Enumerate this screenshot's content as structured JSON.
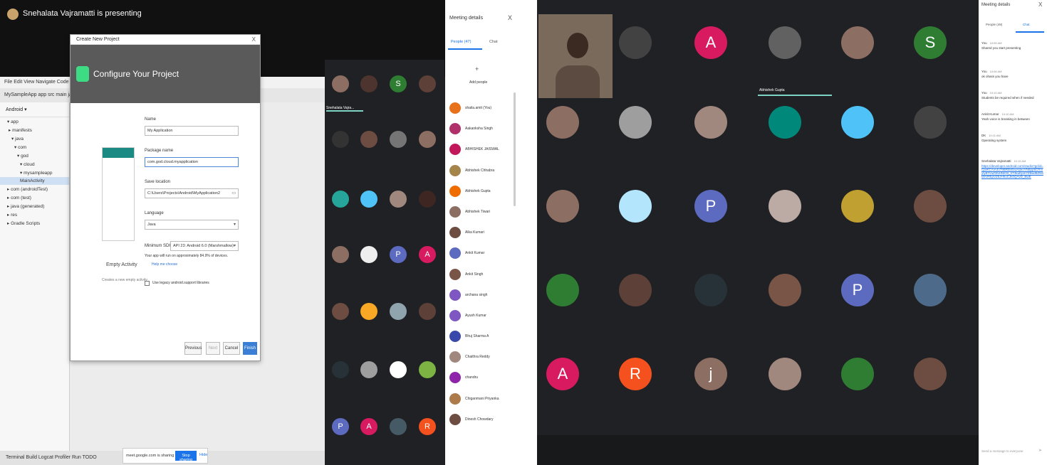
{
  "left": {
    "presenter_text": "Snehalata Vajramatti is presenting",
    "studio": {
      "menu": "File  Edit  View  Navigate  Code  Analyze  Refactor  Build  Run  Tools  VCS  Window  Help",
      "breadcrumb": "MySampleApp  app  src  main  java  com  god  cloud  mysampleapp  MainActivity",
      "tree_header": "Android ▾",
      "tree_items": [
        "▾ app",
        "▸ manifests",
        "▾ java",
        "▾ com",
        "▾ god",
        "▾ cloud",
        "▾ mysampleapp",
        "MainActivity",
        "▸ com (androidTest)",
        "▸ com (test)",
        "▸ java (generated)",
        "▸ res",
        "▸ Gradle Scripts"
      ],
      "statusbar": "Terminal   Build   Logcat   Profiler   Run   TODO",
      "dialog": {
        "title": "Create New Project",
        "close": "X",
        "header": "Configure Your Project",
        "activity_label": "Empty Activity",
        "activity_desc": "Creates a new empty activity",
        "name_label": "Name",
        "name_value": "My Application",
        "package_label": "Package name",
        "package_value": "com.god.cloud.myapplication",
        "save_label": "Save location",
        "save_value": "C:\\Users\\Projects\\Android\\MyApplication2",
        "language_label": "Language",
        "language_value": "Java",
        "minsdk_label": "Minimum SDK",
        "minsdk_value": "API 23: Android 6.0 (Marshmallow)",
        "note": "Your app will run on approximately 84.9% of devices.",
        "note_link": "Help me choose",
        "legacy_label": "Use legacy android.support libraries",
        "buttons": {
          "previous": "Previous",
          "next": "Next",
          "cancel": "Cancel",
          "finish": "Finish"
        }
      }
    },
    "share_text": "meet.google.com is sharing your screen.",
    "share_button": "Stop sharing",
    "share_hide": "Hide",
    "presenter_tag": "Snehalata Vajra...",
    "panel": {
      "title": "Meeting details",
      "close": "X",
      "tab_people": "People (47)",
      "tab_chat": "Chat",
      "add_icon_glyph": "+",
      "add_label": "Add people",
      "people": [
        {
          "name": "shaila.amit (You)",
          "color": "#e8711c"
        },
        {
          "name": "Aakanksha Singh",
          "color": "#b0306a"
        },
        {
          "name": "ABHISHEK JAISWAL",
          "color": "#c2185b"
        },
        {
          "name": "Abhishek Chhabra",
          "color": "#a5854a"
        },
        {
          "name": "Abhishek Gupta",
          "color": "#ef6c00"
        },
        {
          "name": "Abhishek Tiwari",
          "color": "#8d6e63"
        },
        {
          "name": "Alka Kumari",
          "color": "#6d4c41"
        },
        {
          "name": "Ankit Kumar",
          "color": "#5c6bc0"
        },
        {
          "name": "Ankit Singh",
          "color": "#795548"
        },
        {
          "name": "archana singh",
          "color": "#7e57c2"
        },
        {
          "name": "Ayush Kumar",
          "color": "#7e57c2"
        },
        {
          "name": "Bhuj Sharma A",
          "color": "#3949ab"
        },
        {
          "name": "Chaithra Reddy",
          "color": "#a1887f"
        },
        {
          "name": "chandru",
          "color": "#8e24aa"
        },
        {
          "name": "Chiganmani Priyanka",
          "color": "#ad7a4a"
        },
        {
          "name": "Dinesh Chowdary",
          "color": "#6d4c41"
        }
      ]
    },
    "tiles": [
      {
        "letter": "",
        "color": "#8d6e63"
      },
      {
        "letter": "",
        "color": "#4e342e"
      },
      {
        "letter": "S",
        "color": "#2e7d32"
      },
      {
        "letter": "",
        "color": "#5d4037"
      },
      {
        "letter": "",
        "color": "#333333"
      },
      {
        "letter": "",
        "color": "#6d4c41"
      },
      {
        "letter": "",
        "color": "#757575"
      },
      {
        "letter": "",
        "color": "#8d6e63"
      },
      {
        "letter": "",
        "color": "#26a69a"
      },
      {
        "letter": "",
        "color": "#4fc3f7"
      },
      {
        "letter": "",
        "color": "#a1887f"
      },
      {
        "letter": "",
        "color": "#3e2723"
      },
      {
        "letter": "",
        "color": "#8d6e63"
      },
      {
        "letter": "",
        "color": "#eeeeee"
      },
      {
        "letter": "P",
        "color": "#5c6bc0"
      },
      {
        "letter": "A",
        "color": "#d81b60"
      },
      {
        "letter": "",
        "color": "#6d4c41"
      },
      {
        "letter": "",
        "color": "#f9a825"
      },
      {
        "letter": "",
        "color": "#90a4ae"
      },
      {
        "letter": "",
        "color": "#5d4037"
      },
      {
        "letter": "",
        "color": "#263238"
      },
      {
        "letter": "",
        "color": "#9e9e9e"
      },
      {
        "letter": "",
        "color": "#ffffff"
      },
      {
        "letter": "",
        "color": "#7cb342"
      },
      {
        "letter": "P",
        "color": "#5c6bc0"
      },
      {
        "letter": "A",
        "color": "#d81b60"
      },
      {
        "letter": "",
        "color": "#455a64"
      },
      {
        "letter": "R",
        "color": "#f4511e"
      }
    ]
  },
  "right": {
    "speaker_tag": "Abhishek Gupta",
    "tiles": [
      {
        "letter": "",
        "color": "#424242"
      },
      {
        "letter": "A",
        "color": "#d81b60"
      },
      {
        "letter": "",
        "color": "#616161"
      },
      {
        "letter": "",
        "color": "#8d6e63"
      },
      {
        "letter": "S",
        "color": "#2e7d32"
      },
      {
        "letter": "",
        "color": "#8d6e63"
      },
      {
        "letter": "",
        "color": "#9e9e9e"
      },
      {
        "letter": "",
        "color": "#a1887f"
      },
      {
        "letter": "",
        "color": "#00897b"
      },
      {
        "letter": "",
        "color": "#4fc3f7"
      },
      {
        "letter": "",
        "color": "#424242"
      },
      {
        "letter": "",
        "color": "#8d6e63"
      },
      {
        "letter": "",
        "color": "#b3e5fc"
      },
      {
        "letter": "P",
        "color": "#5c6bc0"
      },
      {
        "letter": "",
        "color": "#bcaaa4"
      },
      {
        "letter": "",
        "color": "#c0a030"
      },
      {
        "letter": "",
        "color": "#6d4c41"
      },
      {
        "letter": "",
        "color": "#2e7d32"
      },
      {
        "letter": "",
        "color": "#5d4037"
      },
      {
        "letter": "",
        "color": "#263238"
      },
      {
        "letter": "",
        "color": "#795548"
      },
      {
        "letter": "P",
        "color": "#5c6bc0"
      },
      {
        "letter": "",
        "color": "#4e6a8a"
      },
      {
        "letter": "A",
        "color": "#d81b60"
      },
      {
        "letter": "R",
        "color": "#f4511e"
      },
      {
        "letter": "j",
        "color": "#8d6e63"
      },
      {
        "letter": "",
        "color": "#a1887f"
      },
      {
        "letter": "",
        "color": "#2e7d32"
      },
      {
        "letter": "",
        "color": "#6d4c41"
      }
    ],
    "panel": {
      "title": "Meeting details",
      "close": "X",
      "tab_people": "People (49)",
      "tab_chat": "Chat",
      "messages": [
        {
          "who": "You",
          "time": "10:05 AM",
          "text": "Shared you start presenting",
          "link": ""
        },
        {
          "who": "You",
          "time": "10:06 AM",
          "text": "ok ohass you have",
          "link": ""
        },
        {
          "who": "You",
          "time": "10:10 AM",
          "text": "Students be required when if needed",
          "link": ""
        },
        {
          "who": "Ankit Kumar",
          "time": "10:10 AM",
          "text": "Yeah voice is breaking in between",
          "link": ""
        },
        {
          "who": "DK",
          "time": "10:11 AM",
          "text": "Operating system",
          "link": ""
        },
        {
          "who": "Snehalata Vajramatti",
          "time": "10:15 AM",
          "text": "",
          "link": "https://developer.android.com/studio?gclid=CjwKCAiA4o79BRBvEiwAjteoYN8pp5CRmyIy87VuZ3NHNlO0_hT3kuEpm7Z9wd8ZN5MArREpVZ5JHhoCJk0QAvD_BwE"
        }
      ],
      "send_placeholder": "Send a message to everyone",
      "send_icon": "➤"
    }
  }
}
